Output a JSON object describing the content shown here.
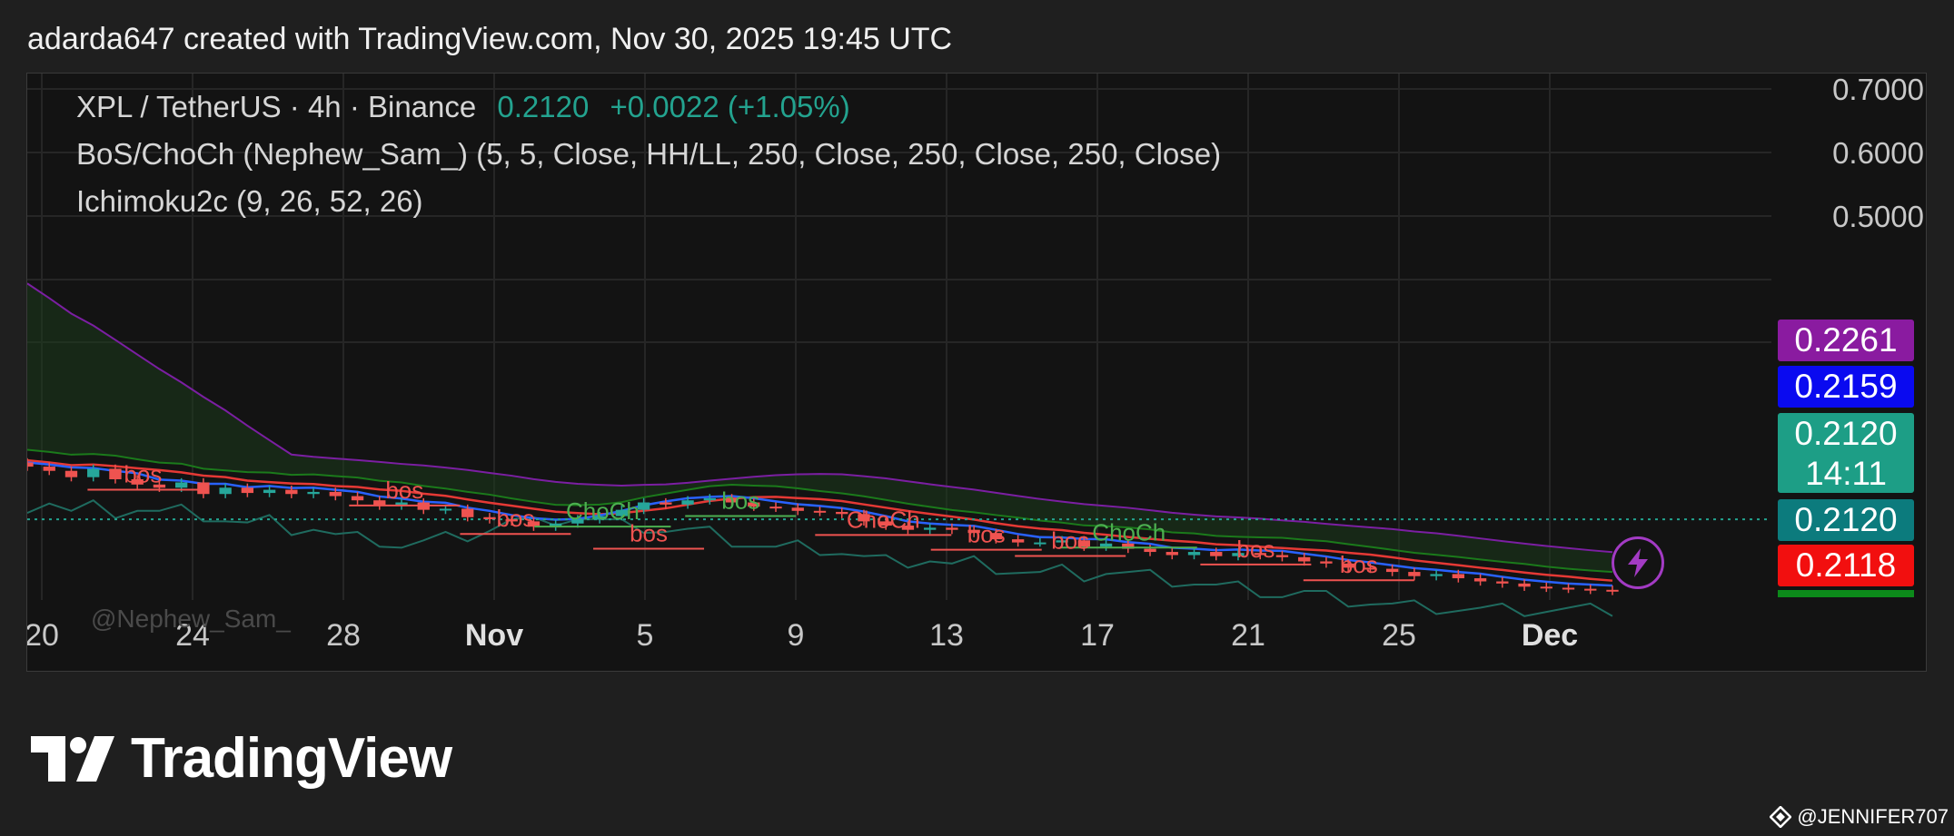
{
  "header": {
    "text": "adarda647 created with TradingView.com, Nov 30, 2025 19:45 UTC"
  },
  "legend": {
    "symbol": "XPL / TetherUS · 4h · Binance",
    "price": "0.2120",
    "change": "+0.0022 (+1.05%)",
    "indicator1": "BoS/ChoCh (Nephew_Sam_) (5, 5, Close, HH/LL, 250, Close, 250, Close, 250, Close)",
    "indicator2": "Ichimoku2c (9, 26, 52, 26)"
  },
  "watermark": "@Nephew_Sam_",
  "brand": "TradingView",
  "credit": "@JENNIFER707",
  "colors": {
    "up": "#26a69a",
    "down": "#ef5350",
    "tenkan": "#2962ff",
    "kijun": "#e53935",
    "chikou": "#1f6b5f",
    "spanA": "#1b7a1b",
    "spanB": "#7b1fa2",
    "tag_purple": "#8a1ba0",
    "tag_blue": "#0a0af0",
    "tag_teal": "#1d9e86",
    "tag_darkteal": "#0c7b7d",
    "tag_red": "#f20f0f",
    "tag_green": "#0c8a1a"
  },
  "price_tags": [
    {
      "label": "0.2261",
      "sub": "",
      "color": "tag_purple"
    },
    {
      "label": "0.2159",
      "sub": "",
      "color": "tag_blue"
    },
    {
      "label": "0.2120",
      "sub": "14:11",
      "color": "tag_teal"
    },
    {
      "label": "0.2120",
      "sub": "",
      "color": "tag_darkteal"
    },
    {
      "label": "0.2118",
      "sub": "",
      "color": "tag_red"
    }
  ],
  "chart_data": {
    "type": "candlestick",
    "y_ticks": [
      "0.7000",
      "0.6000",
      "0.5000"
    ],
    "x_ticks": [
      {
        "label": "20",
        "bold": false
      },
      {
        "label": "24",
        "bold": false
      },
      {
        "label": "28",
        "bold": false
      },
      {
        "label": "Nov",
        "bold": true
      },
      {
        "label": "5",
        "bold": false
      },
      {
        "label": "9",
        "bold": false
      },
      {
        "label": "13",
        "bold": false
      },
      {
        "label": "17",
        "bold": false
      },
      {
        "label": "21",
        "bold": false
      },
      {
        "label": "25",
        "bold": false
      },
      {
        "label": "Dec",
        "bold": true
      }
    ],
    "last_price": 0.212,
    "closes": [
      0.262,
      0.258,
      0.252,
      0.26,
      0.25,
      0.245,
      0.242,
      0.247,
      0.236,
      0.242,
      0.237,
      0.24,
      0.236,
      0.238,
      0.234,
      0.23,
      0.225,
      0.228,
      0.221,
      0.222,
      0.214,
      0.212,
      0.21,
      0.205,
      0.208,
      0.212,
      0.215,
      0.221,
      0.228,
      0.226,
      0.23,
      0.232,
      0.228,
      0.224,
      0.223,
      0.22,
      0.219,
      0.217,
      0.21,
      0.206,
      0.202,
      0.204,
      0.202,
      0.199,
      0.193,
      0.19,
      0.19,
      0.192,
      0.186,
      0.189,
      0.184,
      0.181,
      0.178,
      0.181,
      0.177,
      0.18,
      0.178,
      0.176,
      0.172,
      0.17,
      0.166,
      0.165,
      0.162,
      0.158,
      0.16,
      0.156,
      0.153,
      0.151,
      0.148,
      0.147,
      0.146,
      0.145,
      0.144
    ],
    "annotations": [
      {
        "text": "bos",
        "kind": "bos",
        "x": 0.073,
        "y": 0.247
      },
      {
        "text": "bos",
        "kind": "bos",
        "x": 0.238,
        "y": 0.232
      },
      {
        "text": "bos",
        "kind": "bos",
        "x": 0.308,
        "y": 0.205
      },
      {
        "text": "ChoCh",
        "kind": "choch",
        "x": 0.363,
        "y": 0.212
      },
      {
        "text": "bos",
        "kind": "bos",
        "x": 0.392,
        "y": 0.191
      },
      {
        "text": "bos",
        "kind": "bos_up",
        "x": 0.45,
        "y": 0.222
      },
      {
        "text": "ChoCh",
        "kind": "bos",
        "x": 0.54,
        "y": 0.204
      },
      {
        "text": "bos",
        "kind": "bos",
        "x": 0.605,
        "y": 0.19
      },
      {
        "text": "ChoCh",
        "kind": "choch",
        "x": 0.695,
        "y": 0.192
      },
      {
        "text": "bos",
        "kind": "bos",
        "x": 0.658,
        "y": 0.184
      },
      {
        "text": "bos",
        "kind": "bos",
        "x": 0.775,
        "y": 0.176
      },
      {
        "text": "bos",
        "kind": "bos",
        "x": 0.84,
        "y": 0.161
      }
    ]
  }
}
